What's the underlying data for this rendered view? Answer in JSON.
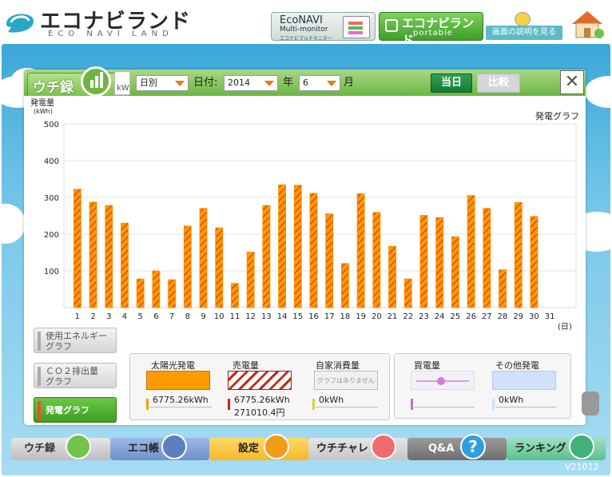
{
  "header": {
    "logo_title": "エコナビランド",
    "logo_sub": "ECO NAVI LAND",
    "econavi": {
      "line1": "EcoNAVI",
      "line2": "Multi-monitor",
      "line3": "エコナビマルチモニター"
    },
    "portable": {
      "line1": "エコナビランド",
      "line2": "portable"
    },
    "help_label": "画面の説明を見る"
  },
  "panel": {
    "tab_label": "ウチ録",
    "peek_label": "kW",
    "period_select": "日別",
    "date_label": "日付:",
    "year_value": "2014",
    "year_label": "年",
    "month_value": "6",
    "month_label": "月",
    "today_button": "当日",
    "compare_button": "比較",
    "close_glyph": "✕"
  },
  "chart_data": {
    "type": "bar",
    "title": "発電グラフ",
    "ylabel": "発電量",
    "yunit": "(kWh)",
    "xlabel": "(日)",
    "ylim": [
      0,
      500
    ],
    "yticks": [
      100,
      200,
      300,
      400,
      500
    ],
    "grid": true,
    "categories": [
      "1",
      "2",
      "3",
      "4",
      "5",
      "6",
      "7",
      "8",
      "9",
      "10",
      "11",
      "12",
      "13",
      "14",
      "15",
      "16",
      "17",
      "18",
      "19",
      "20",
      "21",
      "22",
      "23",
      "24",
      "25",
      "26",
      "27",
      "28",
      "29",
      "30",
      "31"
    ],
    "values": [
      322,
      287,
      278,
      230,
      78,
      100,
      76,
      222,
      270,
      217,
      66,
      151,
      278,
      334,
      333,
      311,
      255,
      120,
      310,
      259,
      167,
      78,
      251,
      245,
      193,
      305,
      270,
      103,
      286,
      248,
      null
    ],
    "bar_fill": "#ff9900",
    "bar_stripe": "#d43a10"
  },
  "side_buttons": [
    {
      "line1": "使用エネルギー",
      "line2": "グラフ"
    },
    {
      "line1": "ＣＯ２排出量",
      "line2": "グラフ"
    },
    {
      "line1": "発電グラフ",
      "line2": ""
    }
  ],
  "legend": {
    "solar": {
      "label": "太陽光発電",
      "value": "6775.26kWh",
      "color": "#ff9a00"
    },
    "sold": {
      "label": "売電量",
      "value": "6775.26kWh",
      "value2": "271010.4円",
      "color": "#c42a1a"
    },
    "self": {
      "label": "自家消費量",
      "swatch_text": "グラフはありません",
      "value": "0kWh",
      "color": "#d6d63a"
    },
    "buy": {
      "label": "買電量",
      "value": "",
      "color": "#b07ab8"
    },
    "other": {
      "label": "その他発電",
      "value": "0kWh",
      "color": "#cfe2f8"
    }
  },
  "nav": {
    "uchi": "ウチ録",
    "eco": "エコ帳",
    "settings": "設定",
    "uchichare": "ウチチャレ",
    "qa": "Q&A",
    "qa_glyph": "?",
    "ranking": "ランキング"
  },
  "version": "V21012"
}
